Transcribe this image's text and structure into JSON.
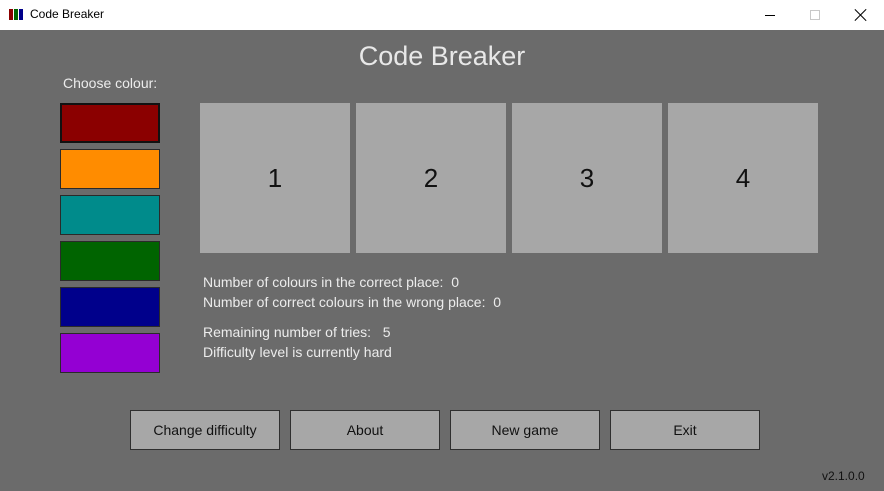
{
  "window": {
    "title": "Code Breaker",
    "icon_colors": [
      "#8b0000",
      "#006400",
      "#00008b"
    ]
  },
  "game": {
    "title": "Code Breaker",
    "choose_label": "Choose colour:",
    "colors": [
      {
        "name": "dark-red",
        "hex": "#8b0000",
        "selected": true
      },
      {
        "name": "orange",
        "hex": "#ff8c00",
        "selected": false
      },
      {
        "name": "teal",
        "hex": "#008b8b",
        "selected": false
      },
      {
        "name": "green",
        "hex": "#006400",
        "selected": false
      },
      {
        "name": "navy",
        "hex": "#00008b",
        "selected": false
      },
      {
        "name": "purple",
        "hex": "#9400d3",
        "selected": false
      }
    ],
    "slots": [
      "1",
      "2",
      "3",
      "4"
    ],
    "info": {
      "correct_place": "Number of colours in the correct place:  0",
      "wrong_place": "Number of correct colours in the wrong place:  0",
      "remaining": "Remaining number of tries:   5",
      "difficulty": "Difficulty level is currently hard"
    }
  },
  "buttons": {
    "change_difficulty": "Change difficulty",
    "about": "About",
    "new_game": "New game",
    "exit": "Exit"
  },
  "version": "v2.1.0.0"
}
